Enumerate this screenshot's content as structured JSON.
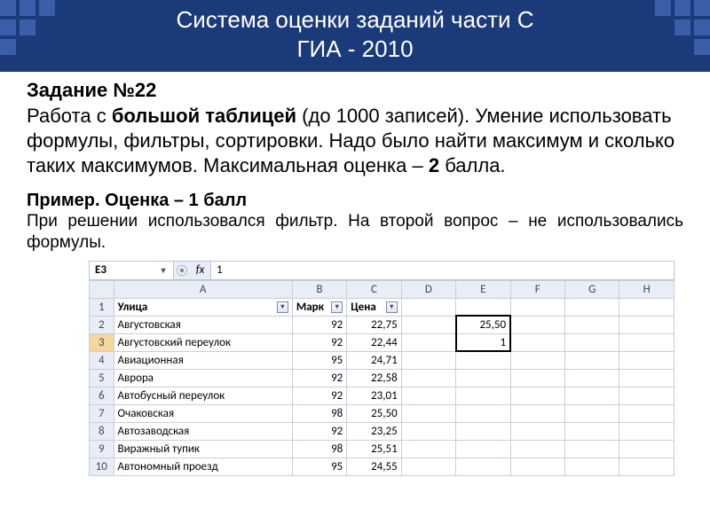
{
  "header": {
    "line1": "Система оценки заданий части С",
    "line2": "ГИА - 2010"
  },
  "task": {
    "title": "Задание №22",
    "body_pre": "Работа с ",
    "body_bold1": "большой таблицей",
    "body_mid": " (до 1000 записей). Умение использовать формулы, фильтры, сортировки. Надо было найти максимум и сколько таких максимумов. Максимальная оценка – ",
    "body_bold2": "2",
    "body_post": " балла."
  },
  "example": {
    "title": "Пример. Оценка – 1 балл",
    "body": "При решении использовался фильтр. На второй вопрос – не использовались формулы."
  },
  "excel": {
    "namebox": "E3",
    "fx_label": "fx",
    "formula_value": "1",
    "col_letters": [
      "A",
      "B",
      "C",
      "D",
      "E",
      "F",
      "G",
      "H"
    ],
    "headers": {
      "A": "Улица",
      "B": "Марк",
      "C": "Цена"
    },
    "rows": [
      {
        "n": 2,
        "A": "Августовская",
        "B": "92",
        "C": "22,75",
        "E": "25,50"
      },
      {
        "n": 3,
        "A": "Августовский переулок",
        "B": "92",
        "C": "22,44",
        "E": "1"
      },
      {
        "n": 4,
        "A": "Авиационная",
        "B": "95",
        "C": "24,71"
      },
      {
        "n": 5,
        "A": "Аврора",
        "B": "92",
        "C": "22,58"
      },
      {
        "n": 6,
        "A": "Автобусный переулок",
        "B": "92",
        "C": "23,01"
      },
      {
        "n": 7,
        "A": "Очаковская",
        "B": "98",
        "C": "25,50"
      },
      {
        "n": 8,
        "A": "Автозаводская",
        "B": "92",
        "C": "23,25"
      },
      {
        "n": 9,
        "A": "Виражный тупик",
        "B": "98",
        "C": "25,51"
      },
      {
        "n": 10,
        "A": "Автономный проезд",
        "B": "95",
        "C": "24,55"
      }
    ]
  }
}
